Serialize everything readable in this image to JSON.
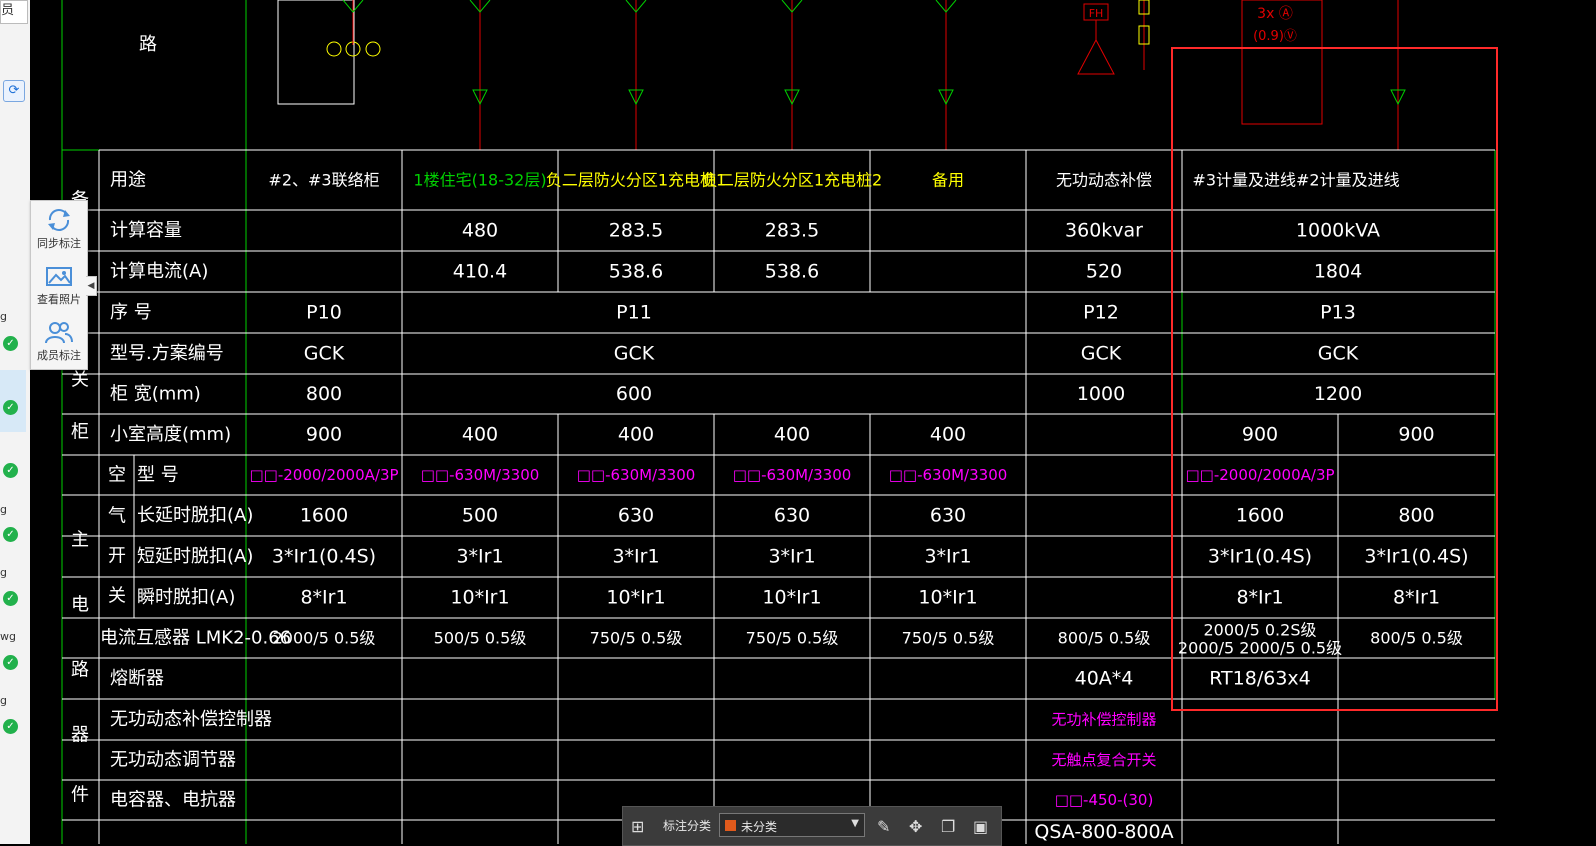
{
  "left_panel": {
    "top_tab": "员",
    "items": [
      "g",
      "g",
      "g",
      "g",
      "wg",
      "g"
    ]
  },
  "toolbar": {
    "sync_label": "同步标注",
    "photo_label": "查看照片",
    "member_label": "成员标注"
  },
  "bottom_bar": {
    "label": "标注分类",
    "select_value": "未分类"
  },
  "drawing": {
    "top_left": "路",
    "fh_label": "FH",
    "ammeter": "3x Ⓐ",
    "voltmeter": "(0.9)Ⓥ",
    "side_labels": [
      "备",
      "关",
      "柜",
      "主",
      "电",
      "路",
      "器",
      "件"
    ],
    "air_switch_chars": [
      "空",
      "气",
      "开",
      "关"
    ],
    "rows": {
      "usage": {
        "label": "用途",
        "cells": [
          "#2、#3联络柜",
          "1楼住宅(18-32层)",
          "负二层防火分区1充电桩1",
          "负二层防火分区1充电桩2",
          "备用",
          "无功动态补偿",
          "#3计量及进线#2计量及进线"
        ]
      },
      "capacity": {
        "label": "计算容量",
        "cells": [
          "480",
          "283.5",
          "283.5",
          "360kvar",
          "1000kVA"
        ]
      },
      "current": {
        "label": "计算电流(A)",
        "cells": [
          "410.4",
          "538.6",
          "538.6",
          "520",
          "1804"
        ]
      },
      "serial": {
        "label": "序 号",
        "cells": [
          "P10",
          "P11",
          "P12",
          "P13"
        ]
      },
      "model": {
        "label": "型号.方案编号",
        "cells": [
          "GCK",
          "GCK",
          "GCK",
          "GCK"
        ]
      },
      "width": {
        "label": "柜 宽(mm)",
        "cells": [
          "800",
          "600",
          "1000",
          "1200"
        ]
      },
      "room": {
        "label": "小室高度(mm)",
        "cells": [
          "900",
          "400",
          "400",
          "400",
          "400",
          "900",
          "900"
        ]
      },
      "breaker_model": {
        "label": "型 号",
        "cells": [
          "□□-2000/2000A/3P",
          "□□-630M/3300",
          "□□-630M/3300",
          "□□-630M/3300",
          "□□-630M/3300",
          "□□-2000/2000A/3P"
        ]
      },
      "long_delay": {
        "label": "长延时脱扣(A)",
        "cells": [
          "1600",
          "500",
          "630",
          "630",
          "630",
          "1600",
          "800"
        ]
      },
      "short_delay": {
        "label": "短延时脱扣(A)",
        "cells": [
          "3*Ir1(0.4S)",
          "3*Ir1",
          "3*Ir1",
          "3*Ir1",
          "3*Ir1",
          "3*Ir1(0.4S)",
          "3*Ir1(0.4S)"
        ]
      },
      "instant": {
        "label": "瞬时脱扣(A)",
        "cells": [
          "8*Ir1",
          "10*Ir1",
          "10*Ir1",
          "10*Ir1",
          "10*Ir1",
          "8*Ir1",
          "8*Ir1"
        ]
      },
      "ct": {
        "label": "电流互感器 LMK2-0.66",
        "cells": [
          "2000/5 0.5级",
          "500/5 0.5级",
          "750/5 0.5级",
          "750/5 0.5级",
          "750/5 0.5级",
          "800/5 0.5级",
          "2000/5 0.2S级",
          "2000/5 2000/5 0.5级",
          "800/5 0.5级"
        ]
      },
      "fuse": {
        "label": "熔断器",
        "cells": [
          "40A*4",
          "RT18/63x4"
        ]
      },
      "controller": {
        "label": "无功动态补偿控制器",
        "cells": [
          "无功补偿控制器"
        ]
      },
      "regulator": {
        "label": "无功动态调节器",
        "cells": [
          "无触点复合开关"
        ]
      },
      "capacitor": {
        "label": "电容器、电抗器",
        "cells": [
          "□□-450-(30)"
        ]
      },
      "partial": {
        "label": "",
        "cells": [
          "QSA-800-800A"
        ]
      }
    }
  },
  "colors": {
    "table_line": "#ffffff",
    "green_line": "#00d000",
    "cad_red": "#e00000",
    "cad_yellow": "#ffff00",
    "cad_magenta": "#ff00ff",
    "highlight_box": "#ff2a2a"
  }
}
